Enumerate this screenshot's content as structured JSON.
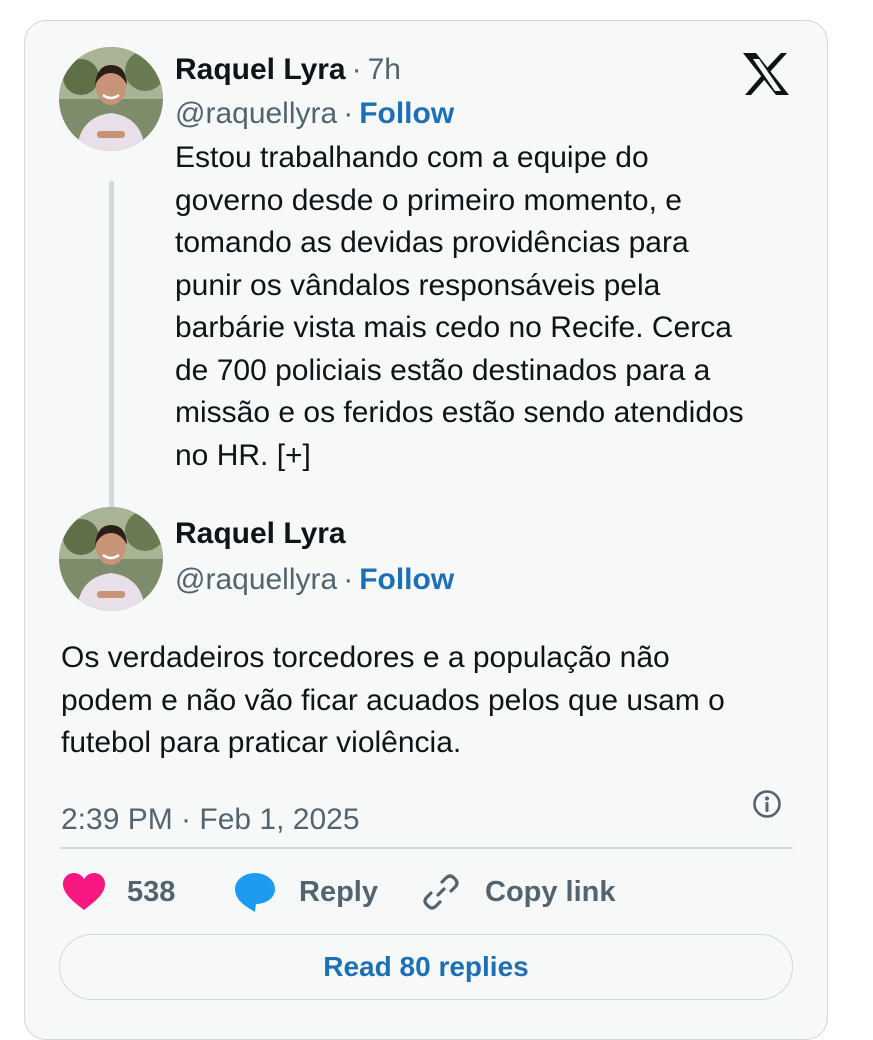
{
  "reply_tweet": {
    "author_name": "Raquel Lyra",
    "time_ago": "7h",
    "handle": "@raquellyra",
    "follow_label": "Follow",
    "lines": [
      "Estou trabalhando com a equipe do",
      "governo desde o primeiro momento, e",
      "tomando as devidas providências para",
      "punir os vândalos responsáveis pela",
      "barbárie vista mais cedo no Recife. Cerca",
      "de 700 policiais estão destinados para a",
      "missão e os feridos estão sendo atendidos",
      "no HR. [+]"
    ]
  },
  "main_tweet": {
    "author_name": "Raquel Lyra",
    "handle": "@raquellyra",
    "follow_label": "Follow",
    "lines": [
      "Os verdadeiros torcedores e a população não",
      "podem e não vão ficar acuados pelos que usam o",
      "futebol para praticar violência."
    ],
    "timestamp": "2:39 PM · Feb 1, 2025"
  },
  "actions": {
    "like_count": "538",
    "reply_label": "Reply",
    "copy_link_label": "Copy link"
  },
  "read_replies_label": "Read 80 replies",
  "icons": {
    "brand": "x-logo-icon",
    "like": "heart-icon",
    "reply": "speech-bubble-icon",
    "copy": "link-icon",
    "info": "info-icon"
  },
  "colors": {
    "heart": "#f91880",
    "reply_bubble": "#1d9bf0",
    "link_blue": "#1d6fb8",
    "card_bg": "#f7f9f9",
    "border": "#cfd9de",
    "secondary_text": "#536471"
  }
}
